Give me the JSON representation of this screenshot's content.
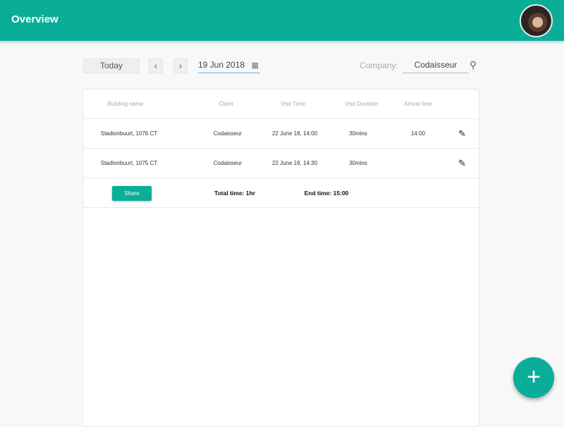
{
  "header": {
    "title": "Overview"
  },
  "toolbar": {
    "today": "Today",
    "prev": "‹",
    "next": "›",
    "date": "19 Jun 2018",
    "company_label": "Company:",
    "company": "Codaisseur"
  },
  "table": {
    "columns": [
      "Building name",
      "Client",
      "Visit Time",
      "Visit Duration",
      "Arrival time"
    ],
    "rows": [
      {
        "building": "Stadionbuurt, 1076 CT",
        "client": "Codaisseur",
        "visit_time": "22 June 18, 14:00",
        "duration": "30mins",
        "arrival": "14:00"
      },
      {
        "building": "Stadionbuurt, 1075 CT",
        "client": "Codaisseur",
        "visit_time": "22 June 18, 14:30",
        "duration": "30mins",
        "arrival": ""
      }
    ],
    "footer": {
      "share": "Share",
      "total": "Total time: 1hr",
      "end": "End time: 15:00"
    }
  },
  "fab": "+"
}
